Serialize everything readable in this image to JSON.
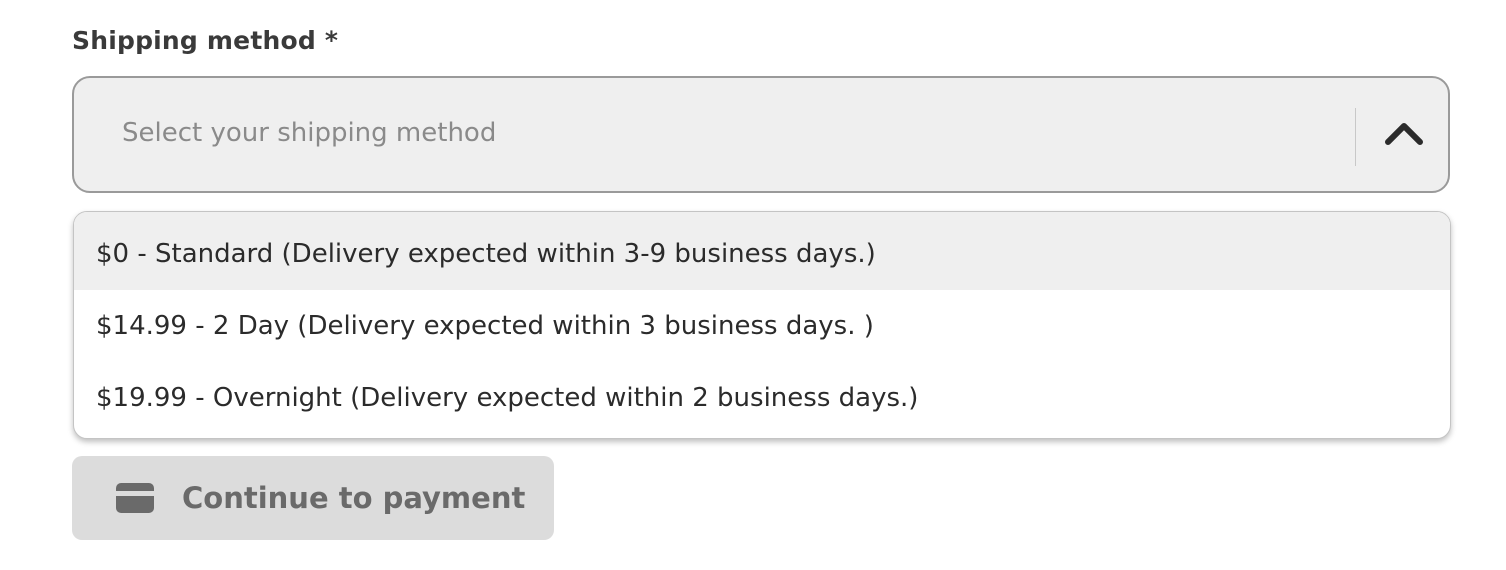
{
  "shipping": {
    "label": "Shipping method *",
    "placeholder": "Select your shipping method",
    "options": [
      "$0 - Standard (Delivery expected within 3-9 business days.)",
      "$14.99 - 2 Day (Delivery expected within 3 business days. )",
      "$19.99 - Overnight (Delivery expected within 2 business days.)"
    ]
  },
  "actions": {
    "continue_label": "Continue to payment",
    "continue_icon": "credit-card-icon"
  }
}
